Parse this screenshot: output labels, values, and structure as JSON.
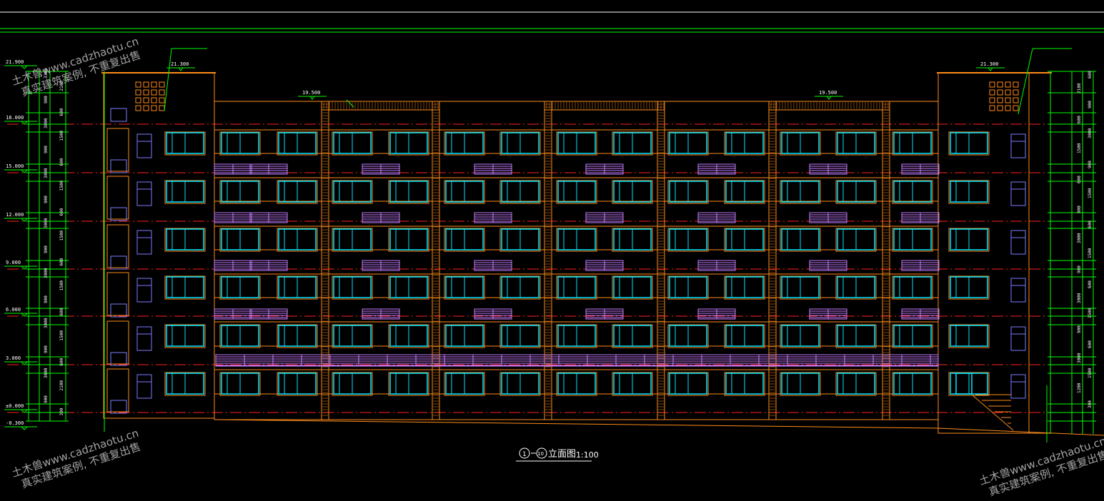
{
  "drawing": {
    "title_prefix": "①-⑩",
    "title_main": "立面图",
    "title_scale": "1:100",
    "title_circle_a": "1",
    "title_circle_b": "10"
  },
  "level_marks": [
    "21.900",
    "18.000",
    "15.000",
    "12.000",
    "9.000",
    "6.000",
    "3.000",
    "±0.000",
    "-0.300"
  ],
  "top_marks": {
    "parapet_left": "21.300",
    "parapet_right": "21.300",
    "roof_left": "19.500",
    "roof_right": "19.500"
  },
  "dim_left": [
    "3300",
    "2100",
    "900",
    "600",
    "3000",
    "1500",
    "900",
    "600",
    "3000",
    "1500",
    "900",
    "600",
    "3000",
    "1500",
    "900",
    "600",
    "3000",
    "1500",
    "900",
    "600",
    "3000",
    "1500",
    "900",
    "600",
    "3600",
    "2100",
    "900",
    "300"
  ],
  "dim_right": [
    "600",
    "2100",
    "900",
    "600",
    "3000",
    "1500",
    "900",
    "600",
    "1500",
    "900",
    "600",
    "3000",
    "1500",
    "900",
    "600",
    "3000",
    "1500",
    "900",
    "600",
    "3000",
    "1500",
    "1200",
    "300"
  ],
  "colors": {
    "background": "#000000",
    "wall": "#ff8c1a",
    "window": "#00e5ff",
    "louver": "#c77dff",
    "grid": "#ff2020",
    "dimension": "#00ff00",
    "stair_window": "#7b7bff"
  },
  "watermark": {
    "line1": "土木兽www.cadzhaotu.cn",
    "line2": "真实建筑案例, 不重复出售"
  }
}
